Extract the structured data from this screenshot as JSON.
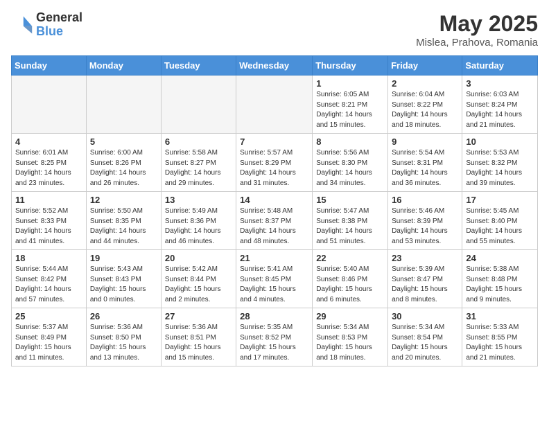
{
  "header": {
    "logo_general": "General",
    "logo_blue": "Blue",
    "month_title": "May 2025",
    "location": "Mislea, Prahova, Romania"
  },
  "weekdays": [
    "Sunday",
    "Monday",
    "Tuesday",
    "Wednesday",
    "Thursday",
    "Friday",
    "Saturday"
  ],
  "weeks": [
    [
      {
        "day": "",
        "empty": true
      },
      {
        "day": "",
        "empty": true
      },
      {
        "day": "",
        "empty": true
      },
      {
        "day": "",
        "empty": true
      },
      {
        "day": "1",
        "sunrise": "6:05 AM",
        "sunset": "8:21 PM",
        "daylight": "14 hours and 15 minutes."
      },
      {
        "day": "2",
        "sunrise": "6:04 AM",
        "sunset": "8:22 PM",
        "daylight": "14 hours and 18 minutes."
      },
      {
        "day": "3",
        "sunrise": "6:03 AM",
        "sunset": "8:24 PM",
        "daylight": "14 hours and 21 minutes."
      }
    ],
    [
      {
        "day": "4",
        "sunrise": "6:01 AM",
        "sunset": "8:25 PM",
        "daylight": "14 hours and 23 minutes."
      },
      {
        "day": "5",
        "sunrise": "6:00 AM",
        "sunset": "8:26 PM",
        "daylight": "14 hours and 26 minutes."
      },
      {
        "day": "6",
        "sunrise": "5:58 AM",
        "sunset": "8:27 PM",
        "daylight": "14 hours and 29 minutes."
      },
      {
        "day": "7",
        "sunrise": "5:57 AM",
        "sunset": "8:29 PM",
        "daylight": "14 hours and 31 minutes."
      },
      {
        "day": "8",
        "sunrise": "5:56 AM",
        "sunset": "8:30 PM",
        "daylight": "14 hours and 34 minutes."
      },
      {
        "day": "9",
        "sunrise": "5:54 AM",
        "sunset": "8:31 PM",
        "daylight": "14 hours and 36 minutes."
      },
      {
        "day": "10",
        "sunrise": "5:53 AM",
        "sunset": "8:32 PM",
        "daylight": "14 hours and 39 minutes."
      }
    ],
    [
      {
        "day": "11",
        "sunrise": "5:52 AM",
        "sunset": "8:33 PM",
        "daylight": "14 hours and 41 minutes."
      },
      {
        "day": "12",
        "sunrise": "5:50 AM",
        "sunset": "8:35 PM",
        "daylight": "14 hours and 44 minutes."
      },
      {
        "day": "13",
        "sunrise": "5:49 AM",
        "sunset": "8:36 PM",
        "daylight": "14 hours and 46 minutes."
      },
      {
        "day": "14",
        "sunrise": "5:48 AM",
        "sunset": "8:37 PM",
        "daylight": "14 hours and 48 minutes."
      },
      {
        "day": "15",
        "sunrise": "5:47 AM",
        "sunset": "8:38 PM",
        "daylight": "14 hours and 51 minutes."
      },
      {
        "day": "16",
        "sunrise": "5:46 AM",
        "sunset": "8:39 PM",
        "daylight": "14 hours and 53 minutes."
      },
      {
        "day": "17",
        "sunrise": "5:45 AM",
        "sunset": "8:40 PM",
        "daylight": "14 hours and 55 minutes."
      }
    ],
    [
      {
        "day": "18",
        "sunrise": "5:44 AM",
        "sunset": "8:42 PM",
        "daylight": "14 hours and 57 minutes."
      },
      {
        "day": "19",
        "sunrise": "5:43 AM",
        "sunset": "8:43 PM",
        "daylight": "15 hours and 0 minutes."
      },
      {
        "day": "20",
        "sunrise": "5:42 AM",
        "sunset": "8:44 PM",
        "daylight": "15 hours and 2 minutes."
      },
      {
        "day": "21",
        "sunrise": "5:41 AM",
        "sunset": "8:45 PM",
        "daylight": "15 hours and 4 minutes."
      },
      {
        "day": "22",
        "sunrise": "5:40 AM",
        "sunset": "8:46 PM",
        "daylight": "15 hours and 6 minutes."
      },
      {
        "day": "23",
        "sunrise": "5:39 AM",
        "sunset": "8:47 PM",
        "daylight": "15 hours and 8 minutes."
      },
      {
        "day": "24",
        "sunrise": "5:38 AM",
        "sunset": "8:48 PM",
        "daylight": "15 hours and 9 minutes."
      }
    ],
    [
      {
        "day": "25",
        "sunrise": "5:37 AM",
        "sunset": "8:49 PM",
        "daylight": "15 hours and 11 minutes."
      },
      {
        "day": "26",
        "sunrise": "5:36 AM",
        "sunset": "8:50 PM",
        "daylight": "15 hours and 13 minutes."
      },
      {
        "day": "27",
        "sunrise": "5:36 AM",
        "sunset": "8:51 PM",
        "daylight": "15 hours and 15 minutes."
      },
      {
        "day": "28",
        "sunrise": "5:35 AM",
        "sunset": "8:52 PM",
        "daylight": "15 hours and 17 minutes."
      },
      {
        "day": "29",
        "sunrise": "5:34 AM",
        "sunset": "8:53 PM",
        "daylight": "15 hours and 18 minutes."
      },
      {
        "day": "30",
        "sunrise": "5:34 AM",
        "sunset": "8:54 PM",
        "daylight": "15 hours and 20 minutes."
      },
      {
        "day": "31",
        "sunrise": "5:33 AM",
        "sunset": "8:55 PM",
        "daylight": "15 hours and 21 minutes."
      }
    ]
  ]
}
